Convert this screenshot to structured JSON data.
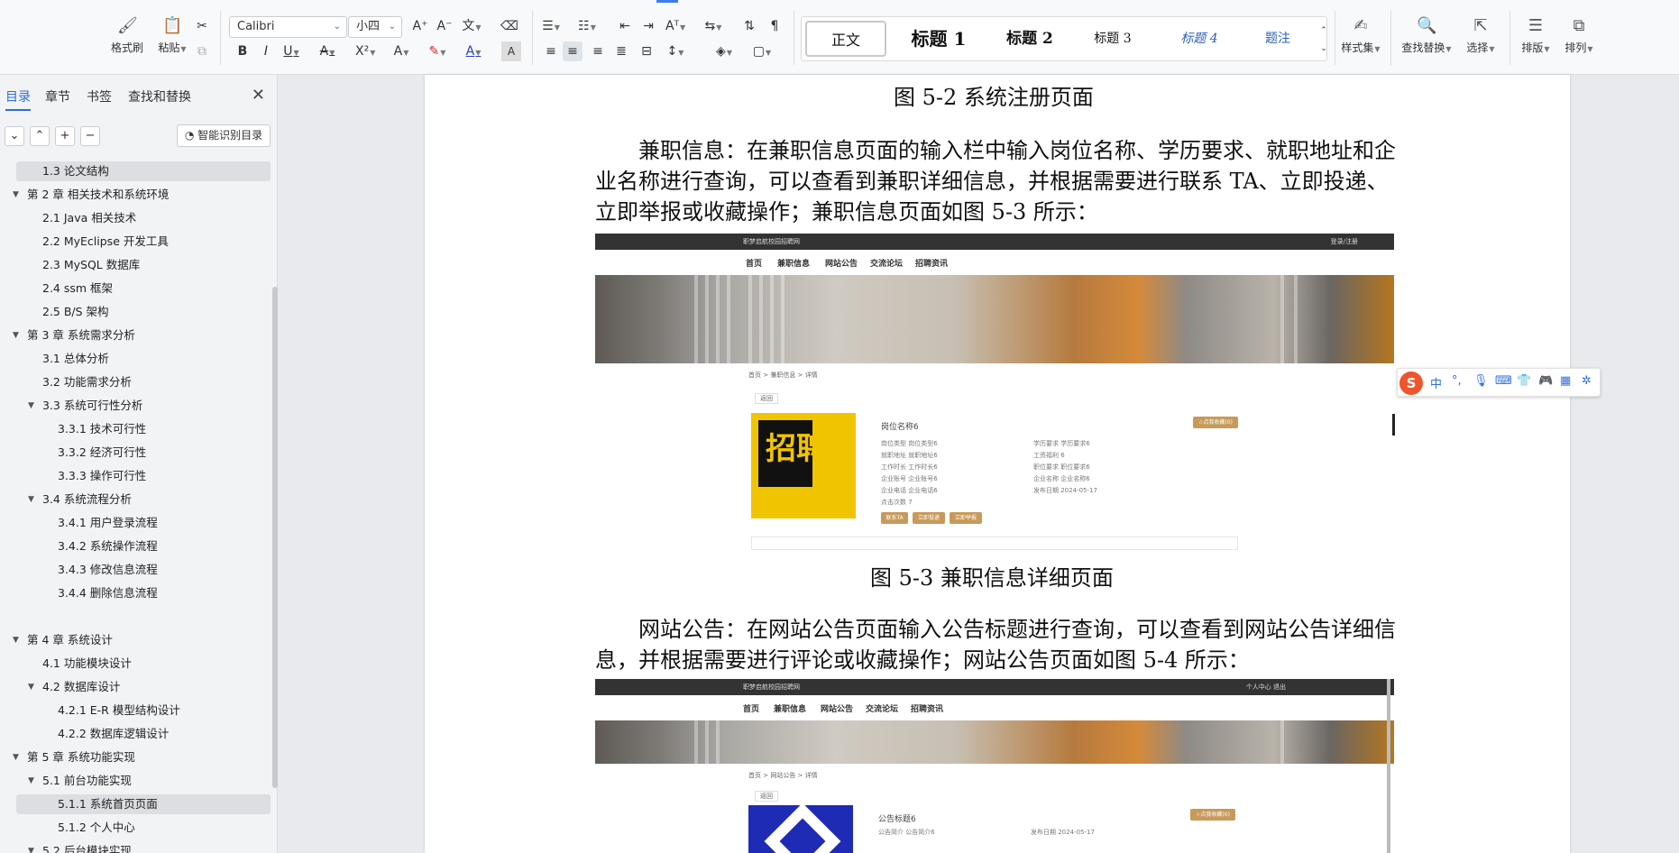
{
  "ribbon": {
    "clipboard": {
      "format_painter": "格式刷",
      "paste": "粘贴"
    },
    "font_name": "Calibri",
    "font_size": "小四",
    "styles": [
      "正文",
      "标题 1",
      "标题 2",
      "标题 3",
      "标题 4",
      "题注"
    ],
    "styles_set": "样式集",
    "find_replace": "查找替换",
    "select": "选择",
    "layout": "排版",
    "arrange": "排列"
  },
  "nav_panel": {
    "tabs": [
      "目录",
      "章节",
      "书签",
      "查找和替换"
    ],
    "smart_toc": "智能识别目录",
    "toc": [
      {
        "label": "1.3 论文结构",
        "level": 2,
        "toggle": ""
      },
      {
        "label": "第 2 章 相关技术和系统环境",
        "level": 1,
        "toggle": "▼"
      },
      {
        "label": "2.1 Java 相关技术",
        "level": 2,
        "toggle": ""
      },
      {
        "label": "2.2 MyEclipse 开发工具",
        "level": 2,
        "toggle": ""
      },
      {
        "label": "2.3 MySQL 数据库",
        "level": 2,
        "toggle": ""
      },
      {
        "label": "2.4 ssm 框架",
        "level": 2,
        "toggle": ""
      },
      {
        "label": "2.5 B/S 架构",
        "level": 2,
        "toggle": ""
      },
      {
        "label": "第 3 章  系统需求分析",
        "level": 1,
        "toggle": "▼"
      },
      {
        "label": "3.1 总体分析",
        "level": 2,
        "toggle": ""
      },
      {
        "label": "3.2 功能需求分析",
        "level": 2,
        "toggle": ""
      },
      {
        "label": "3.3  系统可行性分析",
        "level": 2,
        "toggle": "▼"
      },
      {
        "label": "3.3.1 技术可行性",
        "level": 3,
        "toggle": ""
      },
      {
        "label": "3.3.2 经济可行性",
        "level": 3,
        "toggle": ""
      },
      {
        "label": "3.3.3 操作可行性",
        "level": 3,
        "toggle": ""
      },
      {
        "label": "3.4 系统流程分析",
        "level": 2,
        "toggle": "▼"
      },
      {
        "label": "3.4.1  用户登录流程",
        "level": 3,
        "toggle": ""
      },
      {
        "label": "3.4.2  系统操作流程",
        "level": 3,
        "toggle": ""
      },
      {
        "label": "3.4.3 修改信息流程",
        "level": 3,
        "toggle": ""
      },
      {
        "label": "3.4.4 删除信息流程",
        "level": 3,
        "toggle": ""
      },
      {
        "label": "",
        "level": 0,
        "toggle": ""
      },
      {
        "label": "第 4 章  系统设计",
        "level": 1,
        "toggle": "▼"
      },
      {
        "label": "4.1  功能模块设计",
        "level": 2,
        "toggle": ""
      },
      {
        "label": "4.2  数据库设计",
        "level": 2,
        "toggle": "▼"
      },
      {
        "label": "4.2.1 E-R 模型结构设计",
        "level": 3,
        "toggle": ""
      },
      {
        "label": "4.2.2  数据库逻辑设计",
        "level": 3,
        "toggle": ""
      },
      {
        "label": "第 5 章  系统功能实现",
        "level": 1,
        "toggle": "▼"
      },
      {
        "label": "5.1 前台功能实现",
        "level": 2,
        "toggle": "▼"
      },
      {
        "label": "5.1.1 系统首页页面",
        "level": 3,
        "toggle": ""
      },
      {
        "label": "5.1.2 个人中心",
        "level": 3,
        "toggle": ""
      },
      {
        "label": "5.2 后台模块实现",
        "level": 2,
        "toggle": "▼"
      }
    ]
  },
  "document": {
    "caption_52": "图 5-2 系统注册页面",
    "para_1": "兼职信息：在兼职信息页面的输入栏中输入岗位名称、学历要求、就职地址和企业名称进行查询，可以查看到兼职详细信息，并根据需要进行联系 TA、立即投递、立即举报或收藏操作；兼职信息页面如图 5-3 所示：",
    "caption_53": "图 5-3 兼职信息详细页面",
    "para_2": "网站公告：在网站公告页面输入公告标题进行查询，可以查看到网站公告详细信息，并根据需要进行评论或收藏操作；网站公告页面如图 5-4 所示："
  },
  "shot1": {
    "site": "职梦启航校园招聘网",
    "login": "登录/注册",
    "nav": [
      "首页",
      "兼职信息",
      "网站公告",
      "交流论坛",
      "招聘资讯"
    ],
    "crumb": "首页 > 兼职信息 > 详情",
    "back": "返回",
    "title": "岗位名称6",
    "collect": "☆点我收藏(0)",
    "fields_left": [
      "岗位类型  岗位类型6",
      "就职地址  就职地址6",
      "工作时长  工作时长6",
      "企业账号  企业账号6",
      "企业电话  企业电话6",
      "点击次数  7"
    ],
    "fields_right": [
      "学历要求  学历要求6",
      "工资福利  6",
      "职位要求  职位要求6",
      "企业名称  企业名称6",
      "发布日期  2024-05-17"
    ],
    "buttons": [
      "联系TA",
      "立即投递",
      "立即举报"
    ],
    "poster_text": "招聘"
  },
  "shot2": {
    "site": "职梦启航校园招聘网",
    "user": "个人中心   退出",
    "nav": [
      "首页",
      "兼职信息",
      "网站公告",
      "交流论坛",
      "招聘资讯"
    ],
    "crumb": "首页 > 网站公告 > 详情",
    "back": "返回",
    "title": "公告标题6",
    "collect": "☆点我收藏(0)",
    "field_left": "公告简介  公告简介6",
    "field_right": "发布日期  2024-05-17"
  },
  "ime": {
    "logo": "S",
    "mode": "中"
  }
}
